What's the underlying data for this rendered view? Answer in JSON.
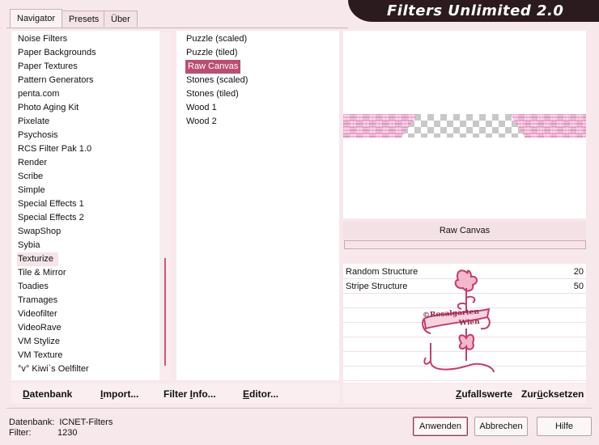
{
  "tabs": [
    "Navigator",
    "Presets",
    "Über"
  ],
  "app_title": "Filters Unlimited 2.0",
  "categories": [
    "Noise Filters",
    "Paper Backgrounds",
    "Paper Textures",
    "Pattern Generators",
    "penta.com",
    "Photo Aging Kit",
    "Pixelate",
    "Psychosis",
    "RCS Filter Pak 1.0",
    "Render",
    "Scribe",
    "Simple",
    "Special Effects 1",
    "Special Effects 2",
    "SwapShop",
    "Sybia",
    "Texturize",
    "Tile & Mirror",
    "Toadies",
    "Tramages",
    "Videofilter",
    "VideoRave",
    "VM Stylize",
    "VM Texture",
    "°v° Kiwi`s Oelfilter"
  ],
  "selected_category": "Texturize",
  "filters": [
    "Puzzle (scaled)",
    "Puzzle (tiled)",
    "Raw Canvas",
    "Stones (scaled)",
    "Stones (tiled)",
    "Wood 1",
    "Wood 2"
  ],
  "selected_filter": "Raw Canvas",
  "preview_filter_name": "Raw Canvas",
  "params": [
    {
      "name": "Random Structure",
      "value": "20"
    },
    {
      "name": "Stripe Structure",
      "value": "50"
    }
  ],
  "watermark_lines": [
    "©Rosalgarten",
    "Wien"
  ],
  "bottom_buttons": {
    "datenbank": {
      "u": "D",
      "rest": "atenbank"
    },
    "import": {
      "u": "I",
      "rest": "mport..."
    },
    "filter_info": {
      "pre": "Filter ",
      "u": "I",
      "rest": "nfo..."
    },
    "editor": {
      "u": "E",
      "rest": "ditor..."
    },
    "random": {
      "u": "Z",
      "rest": "ufallswerte"
    },
    "reset": {
      "pre": "Zur",
      "u": "ü",
      "rest": "cksetzen"
    }
  },
  "status": {
    "db_label": "Datenbank:",
    "db_value": "ICNET-Filters",
    "filter_label": "Filter:",
    "filter_value": "1230"
  },
  "dialog_buttons": {
    "apply": "Anwenden",
    "cancel": "Abbrechen",
    "help": "Hilfe"
  },
  "colors": {
    "accent": "#b94e72",
    "title_bar": "#2b1b1f",
    "background": "#f7e8ec"
  }
}
